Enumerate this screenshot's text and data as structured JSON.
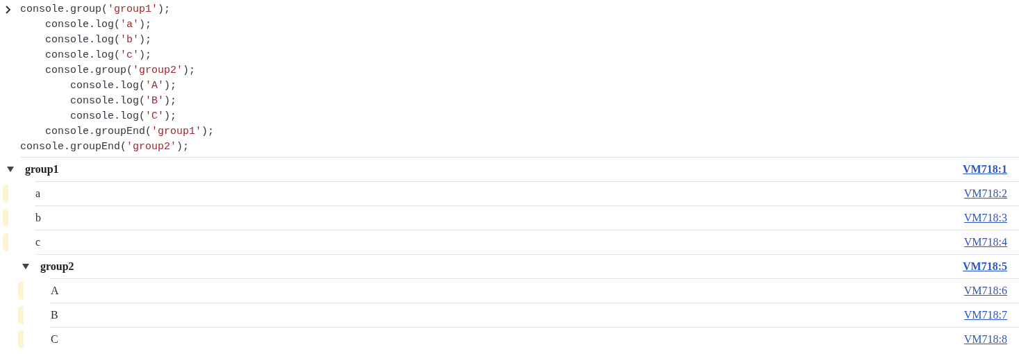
{
  "input": {
    "lines": [
      {
        "before": "console.group(",
        "string": "'group1'",
        "after": ");"
      },
      {
        "before": "    console.log(",
        "string": "'a'",
        "after": ");"
      },
      {
        "before": "    console.log(",
        "string": "'b'",
        "after": ");"
      },
      {
        "before": "    console.log(",
        "string": "'c'",
        "after": ");"
      },
      {
        "before": "    console.group(",
        "string": "'group2'",
        "after": ");"
      },
      {
        "before": "        console.log(",
        "string": "'A'",
        "after": ");"
      },
      {
        "before": "        console.log(",
        "string": "'B'",
        "after": ");"
      },
      {
        "before": "        console.log(",
        "string": "'C'",
        "after": ");"
      },
      {
        "before": "    console.groupEnd(",
        "string": "'group1'",
        "after": ");"
      },
      {
        "before": "console.groupEnd(",
        "string": "'group2'",
        "after": ");"
      }
    ]
  },
  "output": [
    {
      "kind": "group",
      "label": "group1",
      "expanded": true,
      "source": "VM718:1",
      "children": [
        {
          "kind": "log",
          "text": "a",
          "source": "VM718:2"
        },
        {
          "kind": "log",
          "text": "b",
          "source": "VM718:3"
        },
        {
          "kind": "log",
          "text": "c",
          "source": "VM718:4"
        },
        {
          "kind": "group",
          "label": "group2",
          "expanded": true,
          "source": "VM718:5",
          "children": [
            {
              "kind": "log",
              "text": "A",
              "source": "VM718:6"
            },
            {
              "kind": "log",
              "text": "B",
              "source": "VM718:7"
            },
            {
              "kind": "log",
              "text": "C",
              "source": "VM718:8"
            }
          ]
        }
      ]
    }
  ]
}
